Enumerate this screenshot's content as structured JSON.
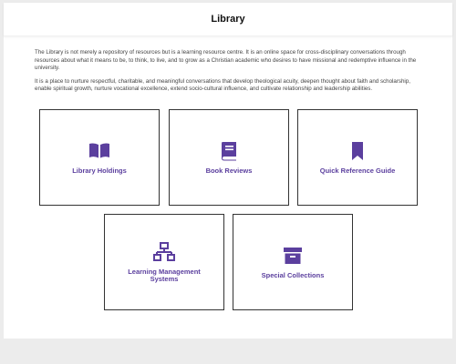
{
  "header": {
    "title": "Library"
  },
  "intro": {
    "paragraph_1": "The Library is not merely a repository of resources but is a learning resource centre. It is an online space for cross-disciplinary conversations through resources about what it means to be, to think, to live, and to grow as a Christian academic who desires to have missional and redemptive influence in the university.",
    "paragraph_2": "It is a place to nurture respectful, charitable, and meaningful conversations that develop theological acuity, deepen thought about faith and scholarship, enable spiritual growth, nurture vocational excellence, extend socio-cultural influence, and cultivate relationship and leadership abilities."
  },
  "cards": [
    {
      "label": "Library Holdings",
      "icon": "open-book-icon"
    },
    {
      "label": "Book Reviews",
      "icon": "book-icon"
    },
    {
      "label": "Quick Reference Guide",
      "icon": "bookmark-icon"
    },
    {
      "label": "Learning Management Systems",
      "icon": "sitemap-icon"
    },
    {
      "label": "Special Collections",
      "icon": "archive-box-icon"
    }
  ],
  "colors": {
    "accent": "#5b3f9e",
    "background": "#ececec",
    "card_border": "#333333"
  }
}
